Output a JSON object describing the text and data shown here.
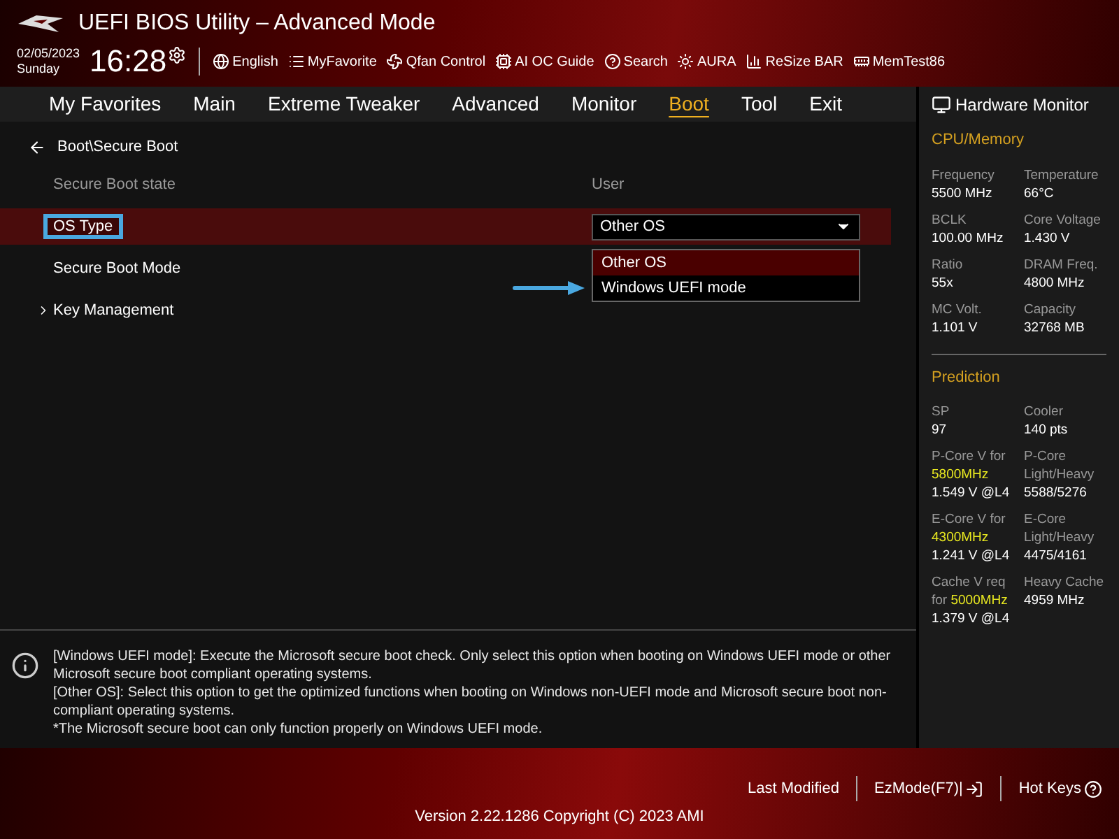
{
  "window": {
    "title": "UEFI BIOS Utility – Advanced Mode"
  },
  "clock": {
    "date": "02/05/2023",
    "day": "Sunday",
    "time": "16:28"
  },
  "toolbar": [
    {
      "label": "English"
    },
    {
      "label": "MyFavorite"
    },
    {
      "label": "Qfan Control"
    },
    {
      "label": "AI OC Guide"
    },
    {
      "label": "Search"
    },
    {
      "label": "AURA"
    },
    {
      "label": "ReSize BAR"
    },
    {
      "label": "MemTest86"
    }
  ],
  "tabs": [
    {
      "label": "My Favorites",
      "selected": false
    },
    {
      "label": "Main",
      "selected": false
    },
    {
      "label": "Extreme Tweaker",
      "selected": false
    },
    {
      "label": "Advanced",
      "selected": false
    },
    {
      "label": "Monitor",
      "selected": false
    },
    {
      "label": "Boot",
      "selected": true
    },
    {
      "label": "Tool",
      "selected": false
    },
    {
      "label": "Exit",
      "selected": false
    }
  ],
  "breadcrumb": "Boot\\Secure Boot",
  "items": [
    {
      "kind": "info",
      "label": "Secure Boot state",
      "value": "User",
      "selected": false,
      "highlighted": false
    },
    {
      "kind": "dropdown",
      "label": "OS Type",
      "value": "Other OS",
      "selected": true,
      "highlighted": true,
      "options": [
        {
          "label": "Other OS",
          "selected": true,
          "pointed": false
        },
        {
          "label": "Windows UEFI mode",
          "selected": false,
          "pointed": true
        }
      ]
    },
    {
      "kind": "text",
      "label": "Secure Boot Mode",
      "selected": false,
      "highlighted": false
    },
    {
      "kind": "submenu",
      "label": "Key Management",
      "selected": false,
      "highlighted": false
    }
  ],
  "help": [
    "[Windows UEFI mode]: Execute the Microsoft secure boot check. Only select this option when booting on Windows UEFI mode or other Microsoft secure boot compliant operating systems.",
    "[Other OS]: Select this option to get the optimized functions when booting on Windows non-UEFI mode and Microsoft secure boot non-compliant operating systems.",
    "*The Microsoft secure boot can only function properly on Windows UEFI mode."
  ],
  "hardware_monitor": {
    "title": "Hardware Monitor",
    "sections": [
      {
        "title": "CPU/Memory",
        "cells": [
          {
            "label": "Frequency",
            "value": "5500 MHz"
          },
          {
            "label": "Temperature",
            "value": "66°C"
          },
          {
            "label": "BCLK",
            "value": "100.00 MHz"
          },
          {
            "label": "Core Voltage",
            "value": "1.430 V"
          },
          {
            "label": "Ratio",
            "value": "55x"
          },
          {
            "label": "DRAM Freq.",
            "value": "4800 MHz"
          },
          {
            "label": "MC Volt.",
            "value": "1.101 V"
          },
          {
            "label": "Capacity",
            "value": "32768 MB"
          }
        ]
      },
      {
        "title": "Prediction",
        "cells": [
          {
            "label": "SP",
            "value": "97"
          },
          {
            "label": "Cooler",
            "value": "140 pts"
          },
          {
            "label": "P-Core V for",
            "highlight": "5800MHz",
            "value": "1.549 V @L4"
          },
          {
            "label": "P-Core Light/Heavy",
            "value": "5588/5276"
          },
          {
            "label": "E-Core V for",
            "highlight": "4300MHz",
            "value": "1.241 V @L4"
          },
          {
            "label": "E-Core Light/Heavy",
            "value": "4475/4161"
          },
          {
            "label": "Cache V req for",
            "highlight": "5000MHz",
            "value": "1.379 V @L4"
          },
          {
            "label": "Heavy Cache",
            "value": "4959 MHz"
          }
        ]
      }
    ]
  },
  "footer": {
    "buttons": [
      {
        "label": "Last Modified"
      },
      {
        "label": "EzMode(F7)|"
      },
      {
        "label": "Hot Keys"
      }
    ],
    "version": "Version 2.22.1286 Copyright (C) 2023 AMI"
  }
}
